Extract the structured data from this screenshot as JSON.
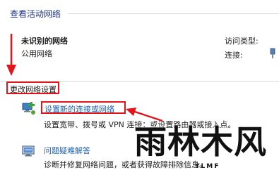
{
  "view_active_networks": {
    "heading": "查看活动网络",
    "network_name": "未识别的网络",
    "network_type": "公用网络",
    "access_type_label": "访问类型:",
    "connection_label": "连接:",
    "connection_icon": "ethernet-icon"
  },
  "change_network_settings": {
    "heading": "更改网络设置",
    "items": [
      {
        "icon": "network-setup-icon",
        "link": "设置新的连接或网络",
        "description": "设置宽带、拨号或 VPN 连接；或设置路由器或接入点。"
      },
      {
        "icon": "troubleshoot-icon",
        "link": "问题疑难解答",
        "description": "诊断并修复网络问题，或者获得故障排除信息。"
      }
    ]
  },
  "annotation": {
    "color": "#e5141b"
  },
  "watermark": {
    "text": "雨林木风",
    "subtext": "YLMF"
  }
}
